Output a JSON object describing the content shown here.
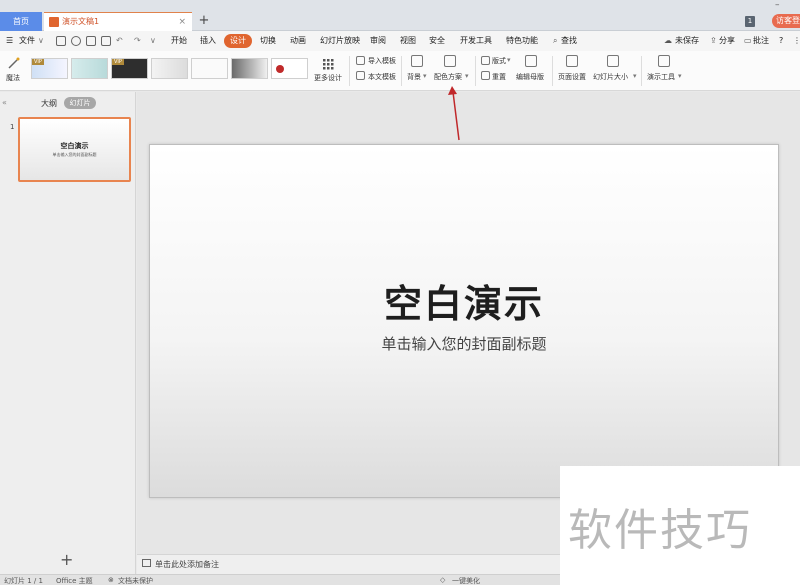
{
  "titlebar": {
    "home_tab": "首页",
    "doc_tab": "演示文稿1",
    "close": "×",
    "new_tab": "+",
    "minimize": "–",
    "badge": "1",
    "visitor": "访客登"
  },
  "menubar": {
    "file": "文件",
    "file_arrow": "∨",
    "tabs": [
      "开始",
      "插入",
      "设计",
      "切换",
      "动画",
      "幻灯片放映",
      "审阅",
      "视图",
      "安全",
      "开发工具",
      "特色功能"
    ],
    "active_tab": "设计",
    "search": "查找",
    "unsaved": "未保存",
    "share": "分享",
    "comment": "批注",
    "help": "?",
    "more": "⋮"
  },
  "ribbon": {
    "magic": "魔法",
    "vip_label": "VIP",
    "more_designs": "更多设计",
    "import_template": "导入模板",
    "this_template": "本文模板",
    "background": "背景",
    "color_scheme": "配色方案",
    "layout": "版式",
    "reset": "重置",
    "edit_master": "编辑母版",
    "page_setup": "页面设置",
    "slide_size": "幻灯片大小",
    "present_tools": "演示工具"
  },
  "leftpanel": {
    "collapse": "«",
    "outline": "大纲",
    "slides": "幻灯片",
    "slide_number": "1",
    "thumb_title": "空白演示",
    "thumb_sub": "单击输入您的封面副标题",
    "add": "+"
  },
  "slide": {
    "title": "空白演示",
    "subtitle": "单击输入您的封面副标题"
  },
  "notes": {
    "placeholder": "单击此处添加备注"
  },
  "statusbar": {
    "slide_counter": "幻灯片 1 / 1",
    "theme": "Office 主题",
    "doc_status": "文档未保护",
    "beautify": "一键美化"
  },
  "watermark": {
    "text": "软件技巧"
  },
  "colors": {
    "accent": "#e0652f",
    "home_tab": "#5b8ce8",
    "annotation_arrow": "#c0282a"
  }
}
